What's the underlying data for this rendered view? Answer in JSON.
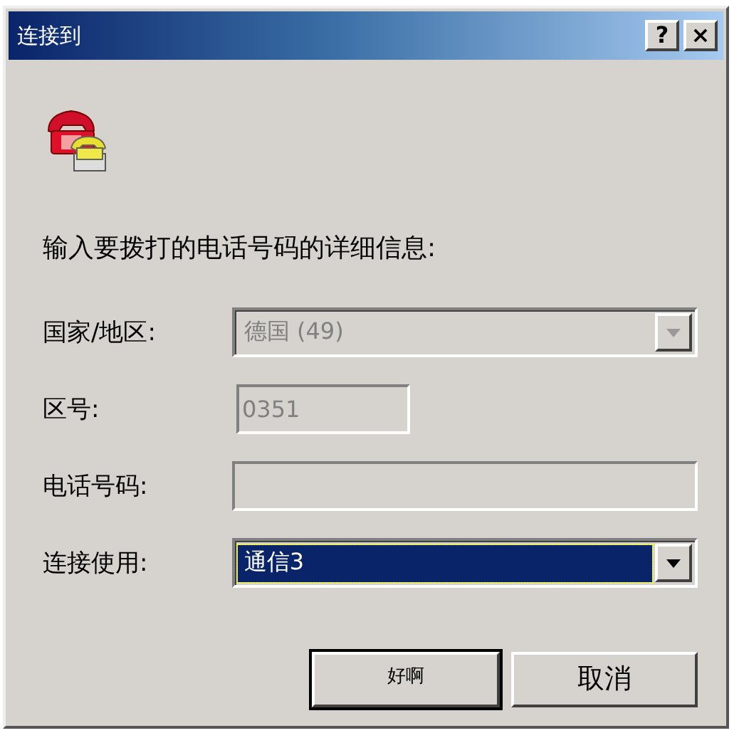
{
  "window": {
    "title": "连接到",
    "help_button": "?",
    "close_button": "×"
  },
  "prompt": "输入要拨打的电话号码的详细信息:",
  "fields": [
    {
      "kind": "dropdown",
      "label": "国家/地区:",
      "value": "德国 (49)",
      "disabled": true,
      "selected": false
    },
    {
      "kind": "text",
      "label": "区号:",
      "value": "0351",
      "disabled": true,
      "selected": false
    },
    {
      "kind": "text",
      "label": "电话号码:",
      "disabled": false,
      "selected": false
    },
    {
      "kind": "dropdown",
      "label": "连接使用:",
      "value": "通信3",
      "disabled": false,
      "selected": true
    }
  ],
  "buttons": [
    {
      "label": "好啊",
      "default": true
    },
    {
      "label": "取消",
      "default": false
    }
  ]
}
